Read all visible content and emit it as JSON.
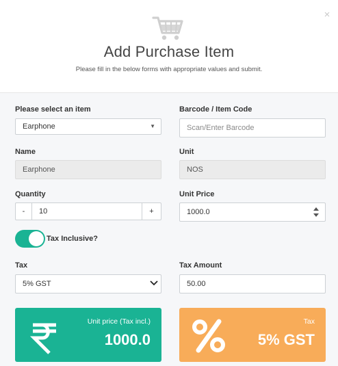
{
  "header": {
    "title": "Add Purchase Item",
    "subtitle": "Please fill in the below forms with appropriate values and submit.",
    "close_glyph": "×",
    "icon": "shopping-cart-icon"
  },
  "form": {
    "item": {
      "label": "Please select an item",
      "value": "Earphone"
    },
    "barcode": {
      "label": "Barcode / Item Code",
      "placeholder": "Scan/Enter Barcode"
    },
    "name": {
      "label": "Name",
      "value": "Earphone"
    },
    "unit": {
      "label": "Unit",
      "value": "NOS"
    },
    "quantity": {
      "label": "Quantity",
      "value": "10",
      "minus": "-",
      "plus": "+"
    },
    "unit_price": {
      "label": "Unit Price",
      "value": "1000.0"
    },
    "tax_inclusive": {
      "label": "Tax Inclusive?",
      "checked": true
    },
    "tax": {
      "label": "Tax",
      "value": "5% GST"
    },
    "tax_amount": {
      "label": "Tax Amount",
      "value": "50.00"
    }
  },
  "cards": {
    "unit_price": {
      "caption": "Unit price (Tax incl.)",
      "value": "1000.0",
      "icon": "rupee-icon"
    },
    "tax": {
      "caption": "Tax",
      "value": "5% GST",
      "icon": "percent-icon"
    }
  },
  "colors": {
    "accent_green": "#1ab394",
    "accent_orange": "#f8ac59"
  }
}
